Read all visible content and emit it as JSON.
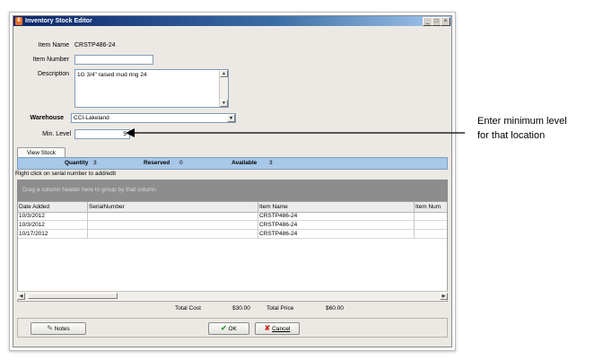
{
  "window": {
    "title": "Inventory Stock Editor",
    "controls": [
      "_",
      "□",
      "×"
    ]
  },
  "form": {
    "item_name_label": "Item Name",
    "item_name_value": "CRSTP486-24",
    "item_number_label": "Item Number",
    "item_number_value": "",
    "description_label": "Description",
    "description_value": "1G 3/4\" raised mud ring 24",
    "warehouse_label": "Warehouse",
    "warehouse_value": "CCI-Lakeland",
    "min_level_label": "Min. Level",
    "min_level_value": "5"
  },
  "tabs": [
    {
      "label": "View Stock"
    }
  ],
  "summary": {
    "quantity_label": "Quantity",
    "quantity_value": "3",
    "reserved_label": "Reserved",
    "reserved_value": "0",
    "available_label": "Available",
    "available_value": "3"
  },
  "hint": "Right click on serial number to add/edit",
  "group_bar": "Drag a column header here to group by that column",
  "table": {
    "headers": [
      "Date Added",
      "SerialNumber",
      "Item Name",
      "Item Num"
    ],
    "rows": [
      [
        "10/3/2012",
        "",
        "CRSTP486-24",
        ""
      ],
      [
        "10/3/2012",
        "",
        "CRSTP486-24",
        ""
      ],
      [
        "10/17/2012",
        "",
        "CRSTP486-24",
        ""
      ]
    ]
  },
  "totals": {
    "cost_label": "Total Cost",
    "cost_value": "$30.00",
    "price_label": "Total Price",
    "price_value": "$60.00"
  },
  "buttons": {
    "notes": "Notes",
    "ok": "OK",
    "cancel": "Cancel"
  },
  "annotation": {
    "line1": "Enter minimum level",
    "line2": "for that location"
  },
  "colors": {
    "summary_bar": "#a8c8e8",
    "group_bar": "#8d8d8d",
    "ok_icon": "#2e9b2e",
    "cancel_icon": "#d02020"
  },
  "icons": {
    "notes": "pencil-icon",
    "ok": "checkmark-icon",
    "cancel": "x-icon",
    "annotation": "arrow-left-icon"
  }
}
